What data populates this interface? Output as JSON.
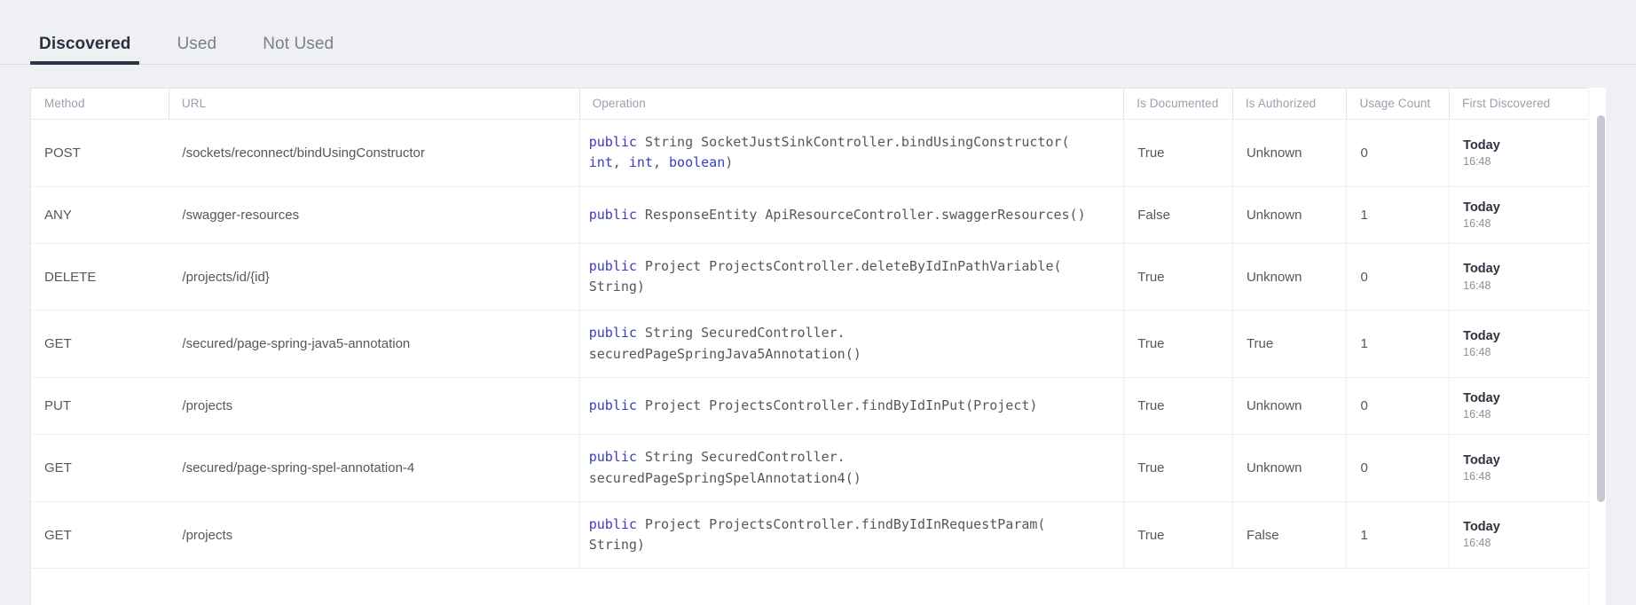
{
  "tabs": [
    {
      "label": "Discovered",
      "active": true
    },
    {
      "label": "Used",
      "active": false
    },
    {
      "label": "Not Used",
      "active": false
    }
  ],
  "table": {
    "columns": [
      "Method",
      "URL",
      "Operation",
      "Is Documented",
      "Is Authorized",
      "Usage Count",
      "First Discovered"
    ],
    "rows": [
      {
        "method": "POST",
        "url": "/sockets/reconnect/bindUsingConstructor",
        "operation_line1_kw": "public",
        "operation_line1_rest": " String SocketJustSinkController.bindUsingConstructor(",
        "operation_line2_parts": [
          {
            "kw": true,
            "text": "int"
          },
          {
            "kw": false,
            "text": ", "
          },
          {
            "kw": true,
            "text": "int"
          },
          {
            "kw": false,
            "text": ", "
          },
          {
            "kw": true,
            "text": "boolean"
          },
          {
            "kw": false,
            "text": ")"
          }
        ],
        "is_documented": "True",
        "is_authorized": "Unknown",
        "usage_count": "0",
        "first_day": "Today",
        "first_time": "16:48"
      },
      {
        "method": "ANY",
        "url": "/swagger-resources",
        "operation_line1_kw": "public",
        "operation_line1_rest": " ResponseEntity ApiResourceController.swaggerResources()",
        "operation_line2_parts": [],
        "is_documented": "False",
        "is_authorized": "Unknown",
        "usage_count": "1",
        "first_day": "Today",
        "first_time": "16:48"
      },
      {
        "method": "DELETE",
        "url": "/projects/id/{id}",
        "operation_line1_kw": "public",
        "operation_line1_rest": " Project ProjectsController.deleteByIdInPathVariable(",
        "operation_line2_parts": [
          {
            "kw": false,
            "text": "String)"
          }
        ],
        "is_documented": "True",
        "is_authorized": "Unknown",
        "usage_count": "0",
        "first_day": "Today",
        "first_time": "16:48"
      },
      {
        "method": "GET",
        "url": "/secured/page-spring-java5-annotation",
        "operation_line1_kw": "public",
        "operation_line1_rest": " String SecuredController.",
        "operation_line2_parts": [
          {
            "kw": false,
            "text": "securedPageSpringJava5Annotation()"
          }
        ],
        "is_documented": "True",
        "is_authorized": "True",
        "usage_count": "1",
        "first_day": "Today",
        "first_time": "16:48"
      },
      {
        "method": "PUT",
        "url": "/projects",
        "operation_line1_kw": "public",
        "operation_line1_rest": " Project ProjectsController.findByIdInPut(Project)",
        "operation_line2_parts": [],
        "is_documented": "True",
        "is_authorized": "Unknown",
        "usage_count": "0",
        "first_day": "Today",
        "first_time": "16:48"
      },
      {
        "method": "GET",
        "url": "/secured/page-spring-spel-annotation-4",
        "operation_line1_kw": "public",
        "operation_line1_rest": " String SecuredController.",
        "operation_line2_parts": [
          {
            "kw": false,
            "text": "securedPageSpringSpelAnnotation4()"
          }
        ],
        "is_documented": "True",
        "is_authorized": "Unknown",
        "usage_count": "0",
        "first_day": "Today",
        "first_time": "16:48"
      },
      {
        "method": "GET",
        "url": "/projects",
        "operation_line1_kw": "public",
        "operation_line1_rest": " Project ProjectsController.findByIdInRequestParam(",
        "operation_line2_parts": [
          {
            "kw": false,
            "text": "String)"
          }
        ],
        "is_documented": "True",
        "is_authorized": "False",
        "usage_count": "1",
        "first_day": "Today",
        "first_time": "16:48"
      }
    ]
  },
  "scrollbar": {
    "name": "vertical-scrollbar"
  },
  "colors": {
    "page_bg": "#eef0f4",
    "card_bg": "#ffffff",
    "tab_active": "#2f3244",
    "tab_inactive": "#7a7f8c",
    "header_text": "#9aa0ac",
    "body_text": "#53585f",
    "code_keyword": "#3b3bbf",
    "row_border": "#eceef2"
  }
}
